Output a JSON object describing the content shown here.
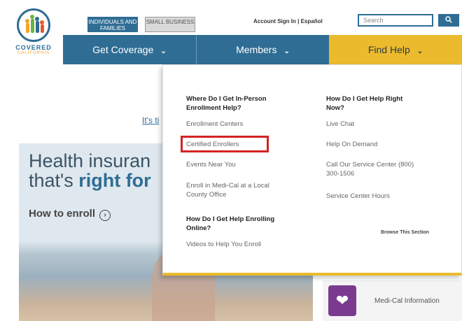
{
  "logo": {
    "title": "COVERED",
    "subtitle": "CALIFORNIA"
  },
  "top_bar": {
    "segment_individuals": "INDIVIDUALS AND FAMILIES",
    "segment_small_business": "SMALL BUSINESS",
    "account_links": "Account Sign In | Español",
    "search_placeholder": "Search",
    "search_button_icon": "search-icon"
  },
  "nav": {
    "get_coverage": "Get Coverage",
    "members": "Members",
    "find_help": "Find Help"
  },
  "page": {
    "its_text": "It's ti",
    "hero_line1": "Health insuran",
    "hero_line2_prefix": "that's ",
    "hero_line2_bold": "right for",
    "how_to_enroll": "How to enroll",
    "medical_info": "Medi-Cal Information"
  },
  "dropdown": {
    "col1_head": "Where Do I Get In-Person Enrollment Help?",
    "col1_links": [
      "Enrollment Centers",
      "Certified Enrollers",
      "Events Near You",
      "Enroll in Medi-Cal at a Local County Office"
    ],
    "col1_head2": "How Do I Get Help Enrolling Online?",
    "col1_links2": [
      "Videos to Help You Enroll"
    ],
    "col2_head": "How Do I Get Help Right Now?",
    "col2_links": [
      "Live Chat",
      "Help On Demand",
      "Call Our Service Center (800) 300-1506",
      "Service Center Hours"
    ],
    "browse": "Browse This Section"
  },
  "colors": {
    "brand_blue": "#2f6d94",
    "accent_yellow": "#ecbb2d",
    "highlight_red": "#d42323"
  }
}
